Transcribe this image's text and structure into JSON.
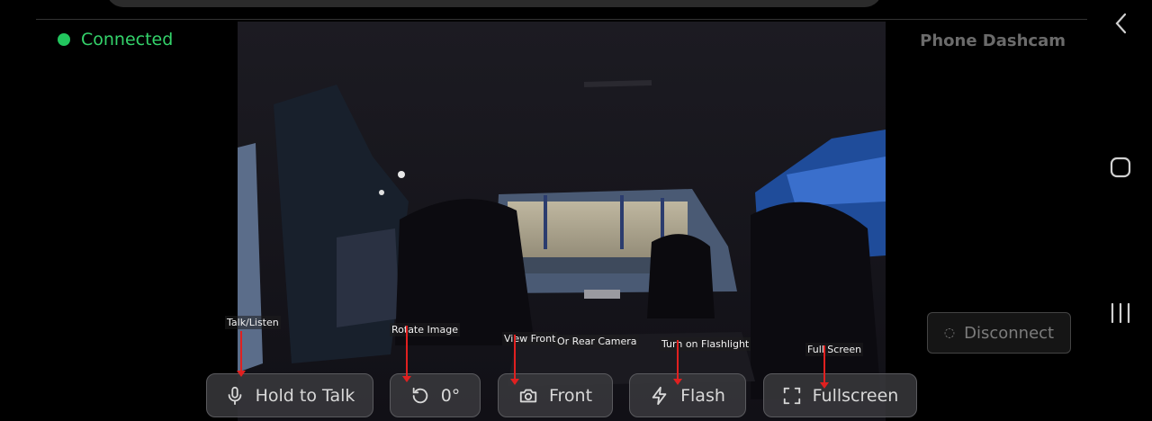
{
  "status": {
    "text": "Connected",
    "color": "#22c55e"
  },
  "app_title": "Phone Dashcam",
  "controls": {
    "talk": {
      "label": "Hold to Talk",
      "icon": "microphone-icon"
    },
    "rotate": {
      "label": "0°",
      "icon": "rotate-icon"
    },
    "camera": {
      "label": "Front",
      "icon": "camera-icon"
    },
    "flash": {
      "label": "Flash",
      "icon": "lightning-icon"
    },
    "fullscreen": {
      "label": "Fullscreen",
      "icon": "fullscreen-icon"
    }
  },
  "annotations": {
    "talk": "Talk/Listen",
    "rotate": "Rotate Image",
    "camera_a": "View Front",
    "camera_b": "Or Rear Camera",
    "flash": "Turn on Flashlight",
    "fullscreen": "Full Screen"
  },
  "disconnect": {
    "label": "Disconnect",
    "icon": "spinner-icon"
  },
  "nav": {
    "back": "back-icon",
    "home": "home-icon",
    "recents": "recents-icon"
  }
}
